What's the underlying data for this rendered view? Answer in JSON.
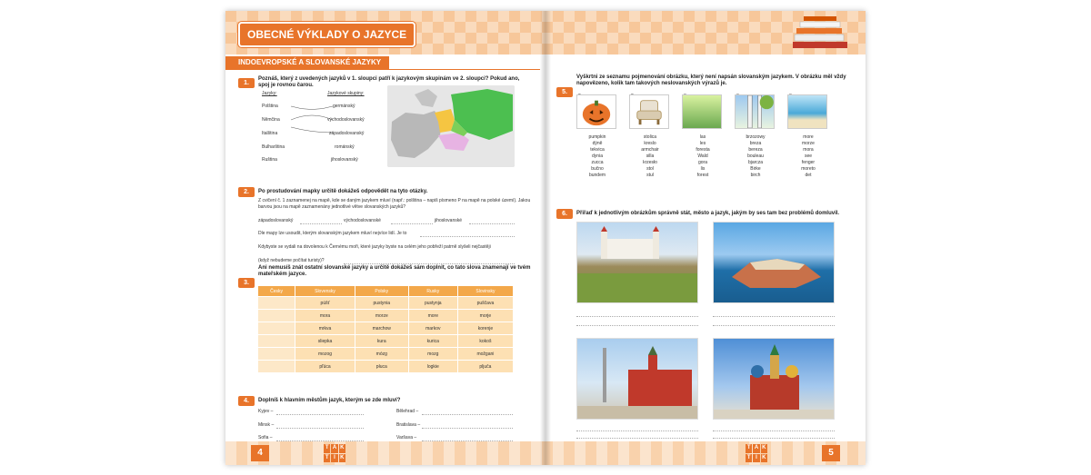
{
  "header": {
    "chapter_title": "OBECNÉ VÝKLADY O JAZYCE"
  },
  "left": {
    "section_title": "INDOEVROPSKÉ A SLOVANSKÉ JAZYKY",
    "page_number": "4",
    "task1": {
      "num": "1.",
      "text": "Poznáš, který z uvedených jazyků v 1. sloupci patří k jazykovým skupinám ve 2. sloupci? Pokud ano, spoj je rovnou čarou.",
      "col1_header": "Jazyky:",
      "col2_header": "Jazykové skupiny:",
      "col1": [
        "Polština",
        "Němčina",
        "Italština",
        "Bulharština",
        "Ruština"
      ],
      "col2": [
        "germánský",
        "východoslovanský",
        "západoslovanský",
        "románský",
        "jihoslovanský"
      ]
    },
    "task2": {
      "num": "2.",
      "text": "Po prostudování mapky určitě dokážeš odpovědět na tyto otázky.",
      "line1": "Z cvičení č. 1 zaznamenej na mapě, kde se daným jazykem mluví (např.: polština – napiš písmeno P na mapě na polské území). Jakou barvou jsou na mapě zaznamenány jednotlivé větve slovanských jazyků?",
      "l_west": "západoslovanský",
      "l_east": "východoslovanské",
      "l_south": "jihoslovanské",
      "line2": "Dle mapy lze usoudit, kterým slovanským jazykem mluví nejvíce lidí. Je to",
      "line3": "Kdybyste se vydali na dovolenou k Černému moři, které jazyky byste na celém jeho pobřeží patrně slyšeli nejčastěji",
      "line4": "(když nebudeme počítat turisty)?"
    },
    "task3": {
      "num": "3.",
      "text": "Ani nemusíš znát ostatní slovanské jazyky a určitě dokážeš sám doplnit, co tato slova znamenají ve tvém mateřském jazyce.",
      "headers": [
        "Česky",
        "Slovensky",
        "Polsky",
        "Rusky",
        "Slovinsky"
      ],
      "rows": [
        [
          "",
          "púšť",
          "pustynia",
          "pustynja",
          "puščava"
        ],
        [
          "",
          "mora",
          "morze",
          "more",
          "morje"
        ],
        [
          "",
          "mrkva",
          "marchow",
          "markov",
          "korenje"
        ],
        [
          "",
          "sliepka",
          "kura",
          "kurica",
          "kokoš"
        ],
        [
          "",
          "mozog",
          "mózg",
          "mozg",
          "možgani"
        ],
        [
          "",
          "pľúca",
          "płuca",
          "logkie",
          "pljuča"
        ]
      ]
    },
    "task4": {
      "num": "4.",
      "text": "Doplníš k hlavním městům jazyk, kterým se zde mluví?",
      "cities_left": [
        "Kyjev –",
        "Minsk –",
        "Sofia –"
      ],
      "cities_right": [
        "Bělehrad –",
        "Bratislava –",
        "Varšava –"
      ]
    }
  },
  "right": {
    "page_number": "5",
    "task5": {
      "num": "5.",
      "text": "Vyškrtni ze seznamu pojmenování obrázku, který není napsán slovanským jazykem. V obrázku měl vždy napovězeno, kolik tam takových neslovanských výrazů je.",
      "counts": [
        "2",
        "2",
        "3",
        "3",
        "3"
      ],
      "columns": [
        [
          "pumpkin",
          "dýně",
          "tekvica",
          "dynia",
          "zucca",
          "bučno",
          "bundem"
        ],
        [
          "stolica",
          "kreslo",
          "armchair",
          "silla",
          "krzesło",
          "stol",
          "stul"
        ],
        [
          "las",
          "les",
          "foresta",
          "Wald",
          "gora",
          "lis",
          "forest"
        ],
        [
          "brzozowy",
          "breza",
          "bereza",
          "bouleau",
          "bjarcza",
          "Birke",
          "birch"
        ],
        [
          "more",
          "morze",
          "mora",
          "see",
          "fenger",
          "moreto",
          "det"
        ]
      ]
    },
    "task6": {
      "num": "6.",
      "text": "Přiřaď k jednotlivým obrázkům správně stát, město a jazyk, jakým by ses tam bez problémů domluvil."
    }
  },
  "logo_letters": [
    "T",
    "A",
    "K",
    "T",
    "I",
    "K"
  ],
  "colors": {
    "accent": "#e8742a",
    "band": "#f7c79a",
    "table_header": "#f3a84a",
    "table_cell": "#fde0b3"
  }
}
